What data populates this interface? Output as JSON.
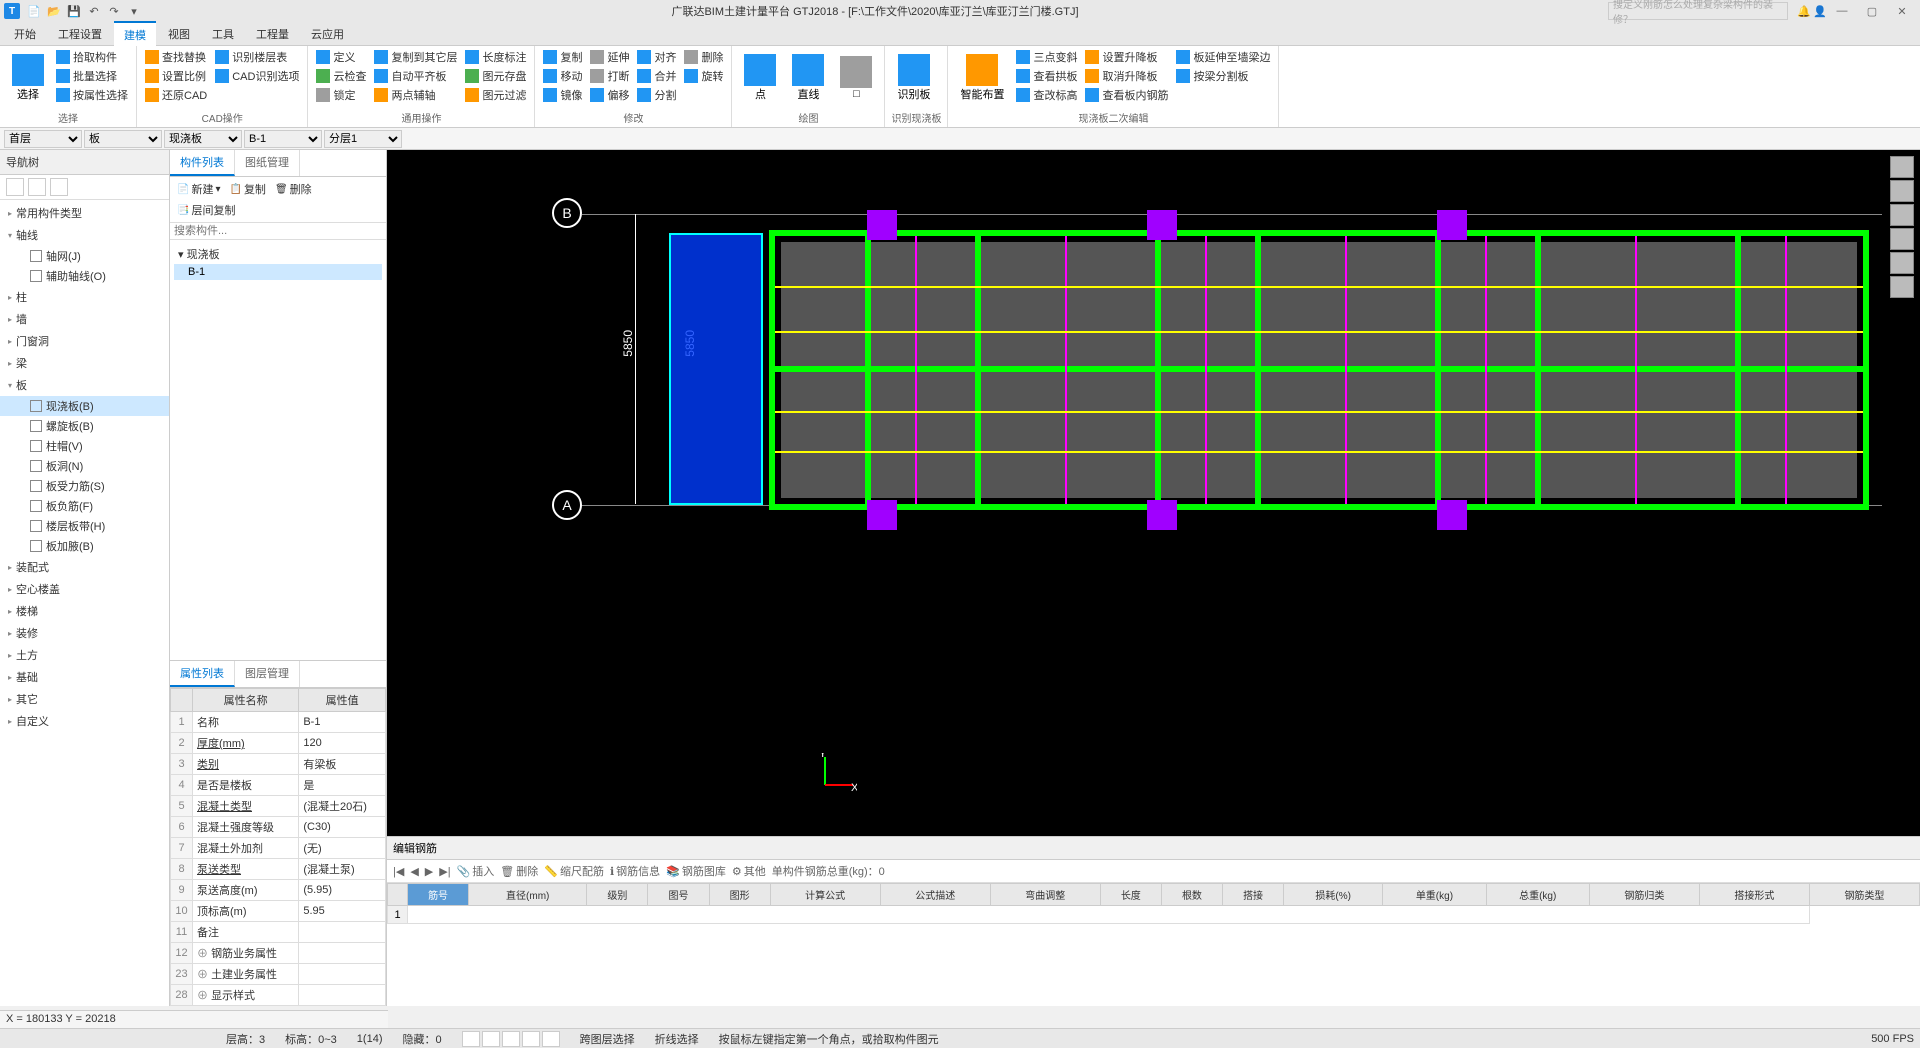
{
  "title": "广联达BIM土建计量平台 GTJ2018 - [F:\\工作文件\\2020\\库亚汀兰\\库亚汀兰门楼.GTJ]",
  "app_icon": "T",
  "search_placeholder": "搜定义刚筋怎么处理复杂梁构件的装修？",
  "menutabs": [
    "开始",
    "工程设置",
    "建模",
    "视图",
    "工具",
    "工程量",
    "云应用"
  ],
  "ribbon": {
    "select_big": "选择",
    "g1": {
      "items": [
        "拾取构件",
        "批量选择",
        "按属性选择"
      ],
      "label": "选择"
    },
    "g2": {
      "items": [
        "查找替换",
        "设置比例",
        "还原CAD",
        "识别楼层表",
        "CAD识别选项"
      ],
      "label": "CAD操作"
    },
    "g3": {
      "items": [
        "定义",
        "云检查",
        "锁定",
        "复制到其它层",
        "自动平齐板",
        "两点辅轴",
        "长度标注",
        "图元存盘",
        "图元过滤"
      ],
      "label": "通用操作"
    },
    "g4": {
      "items": [
        "复制",
        "移动",
        "镜像",
        "延伸",
        "打断",
        "偏移",
        "对齐",
        "合并",
        "分割",
        "删除",
        "旋转"
      ],
      "label": "修改"
    },
    "g5": {
      "items": [
        "点",
        "直线"
      ],
      "label": "绘图"
    },
    "g6": {
      "items": [
        "识别板"
      ],
      "label": "识别现浇板"
    },
    "g7": {
      "big": "智能布置",
      "items": [
        "三点变斜",
        "查看拱板",
        "查改标高",
        "设置升降板",
        "取消升降板",
        "查看板内钢筋",
        "板延伸至墙梁边",
        "按梁分割板"
      ],
      "label": "现浇板二次编辑"
    }
  },
  "dropdowns": {
    "floor": "首层",
    "cat": "板",
    "type": "现浇板",
    "comp": "B-1",
    "layer": "分层1"
  },
  "nav": {
    "title": "导航树",
    "cats": [
      {
        "name": "常用构件类型"
      },
      {
        "name": "轴线",
        "open": true,
        "items": [
          {
            "label": "轴网(J)"
          },
          {
            "label": "辅助轴线(O)"
          }
        ]
      },
      {
        "name": "柱"
      },
      {
        "name": "墙"
      },
      {
        "name": "门窗洞"
      },
      {
        "name": "梁"
      },
      {
        "name": "板",
        "open": true,
        "items": [
          {
            "label": "现浇板(B)",
            "sel": true
          },
          {
            "label": "螺旋板(B)"
          },
          {
            "label": "柱帽(V)"
          },
          {
            "label": "板洞(N)"
          },
          {
            "label": "板受力筋(S)"
          },
          {
            "label": "板负筋(F)"
          },
          {
            "label": "楼层板带(H)"
          },
          {
            "label": "板加腋(B)"
          }
        ]
      },
      {
        "name": "装配式"
      },
      {
        "name": "空心楼盖"
      },
      {
        "name": "楼梯"
      },
      {
        "name": "装修"
      },
      {
        "name": "土方"
      },
      {
        "name": "基础"
      },
      {
        "name": "其它"
      },
      {
        "name": "自定义"
      }
    ]
  },
  "complist": {
    "tabs": [
      "构件列表",
      "图纸管理"
    ],
    "toolbar": [
      "新建",
      "复制",
      "删除",
      "层间复制"
    ],
    "search": "搜索构件...",
    "parent": "现浇板",
    "item": "B-1"
  },
  "proppane": {
    "tabs": [
      "属性列表",
      "图层管理"
    ],
    "headers": [
      "属性名称",
      "属性值"
    ],
    "rows": [
      {
        "n": "1",
        "name": "名称",
        "val": "B-1"
      },
      {
        "n": "2",
        "name": "厚度(mm)",
        "val": "120",
        "link": true
      },
      {
        "n": "3",
        "name": "类别",
        "val": "有梁板",
        "link": true
      },
      {
        "n": "4",
        "name": "是否是楼板",
        "val": "是"
      },
      {
        "n": "5",
        "name": "混凝土类型",
        "val": "(混凝土20石)",
        "link": true
      },
      {
        "n": "6",
        "name": "混凝土强度等级",
        "val": "(C30)"
      },
      {
        "n": "7",
        "name": "混凝土外加剂",
        "val": "(无)"
      },
      {
        "n": "8",
        "name": "泵送类型",
        "val": "(混凝土泵)",
        "link": true
      },
      {
        "n": "9",
        "name": "泵送高度(m)",
        "val": "(5.95)"
      },
      {
        "n": "10",
        "name": "顶标高(m)",
        "val": "5.95"
      },
      {
        "n": "11",
        "name": "备注",
        "val": ""
      },
      {
        "n": "12",
        "name": "钢筋业务属性",
        "val": "",
        "exp": true
      },
      {
        "n": "23",
        "name": "土建业务属性",
        "val": "",
        "exp": true
      },
      {
        "n": "28",
        "name": "显示样式",
        "val": "",
        "exp": true
      }
    ]
  },
  "canvas": {
    "axisA": "A",
    "axisB": "B",
    "dim": "5850",
    "dim2": "5850",
    "y": "Y",
    "x": "X"
  },
  "rebar": {
    "title": "编辑钢筋",
    "toolbar": [
      "插入",
      "删除",
      "缩尺配筋",
      "钢筋信息",
      "钢筋图库",
      "其他"
    ],
    "weight_label": "单构件钢筋总重(kg)：0",
    "headers": [
      "筋号",
      "直径(mm)",
      "级别",
      "图号",
      "图形",
      "计算公式",
      "公式描述",
      "弯曲调整",
      "长度",
      "根数",
      "搭接",
      "损耗(%)",
      "单重(kg)",
      "总重(kg)",
      "钢筋归类",
      "搭接形式",
      "钢筋类型"
    ],
    "row1": "1"
  },
  "coord": "X = 180133 Y = 20218",
  "status": {
    "floor": "层高：3",
    "elev": "标高：0~3",
    "count": "1(14)",
    "hidden": "隐藏：0",
    "cross": "跨图层选择",
    "fold": "折线选择",
    "hint": "按鼠标左键指定第一个角点，或拾取构件图元",
    "fps": "500 FPS"
  }
}
